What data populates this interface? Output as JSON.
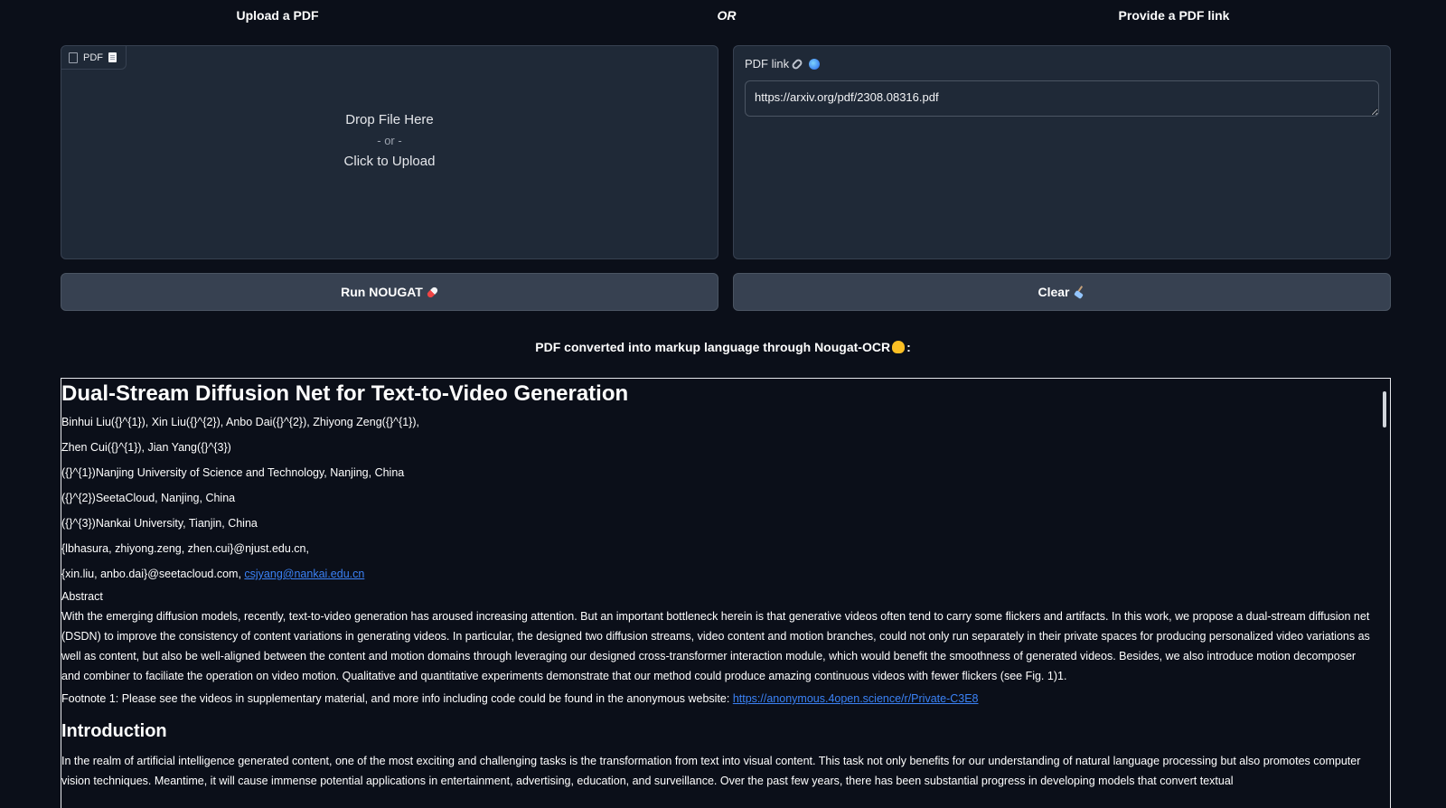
{
  "headers": {
    "upload": "Upload a PDF",
    "or": "OR",
    "link": "Provide a PDF link"
  },
  "upload": {
    "tag_label": "PDF",
    "drop_text": "Drop File Here",
    "or_text": "- or -",
    "click_text": "Click to Upload"
  },
  "link": {
    "label": "PDF link",
    "value": "https://arxiv.org/pdf/2308.08316.pdf"
  },
  "buttons": {
    "run": "Run NOUGAT",
    "clear": "Clear"
  },
  "result": {
    "title": "PDF converted into markup language through Nougat-OCR",
    "title_suffix": ":"
  },
  "document": {
    "title": "Dual-Stream Diffusion Net for Text-to-Video Generation",
    "authors_1": "Binhui Liu({}^{1}), Xin Liu({}^{2}), Anbo Dai({}^{2}), Zhiyong Zeng({}^{1}),",
    "authors_2": "Zhen Cui({}^{1}), Jian Yang({}^{3})",
    "affil_1": "({}^{1})Nanjing University of Science and Technology, Nanjing, China",
    "affil_2": "({}^{2})SeetaCloud, Nanjing, China",
    "affil_3": "({}^{3})Nankai University, Tianjin, China",
    "email_1": "{lbhasura, zhiyong.zeng, zhen.cui}@njust.edu.cn,",
    "email_2_prefix": "{xin.liu, anbo.dai}@seetacloud.com, ",
    "email_2_link": "csjyang@nankai.edu.cn",
    "abstract_label": "Abstract",
    "abstract_text": "With the emerging diffusion models, recently, text-to-video generation has aroused increasing attention. But an important bottleneck herein is that generative videos often tend to carry some flickers and artifacts. In this work, we propose a dual-stream diffusion net (DSDN) to improve the consistency of content variations in generating videos. In particular, the designed two diffusion streams, video content and motion branches, could not only run separately in their private spaces for producing personalized video variations as well as content, but also be well-aligned between the content and motion domains through leveraging our designed cross-transformer interaction module, which would benefit the smoothness of generated videos. Besides, we also introduce motion decomposer and combiner to faciliate the operation on video motion. Qualitative and quantitative experiments demonstrate that our method could produce amazing continuous videos with fewer flickers (see Fig. 1)1.",
    "footnote_prefix": "Footnote 1: Please see the videos in supplementary material, and more info including code could be found in the anonymous website: ",
    "footnote_link": "https://anonymous.4open.science/r/Private-C3E8",
    "intro_heading": "Introduction",
    "intro_text": "In the realm of artificial intelligence generated content, one of the most exciting and challenging tasks is the transformation from text into visual content. This task not only benefits for our understanding of natural language processing but also promotes computer vision techniques. Meantime, it will cause immense potential applications in entertainment, advertising, education, and surveillance. Over the past few years, there has been substantial progress in developing models that convert textual"
  },
  "icons": {
    "file": "file-icon",
    "pdf_doc": "page-emoji-icon",
    "link": "link-emoji-icon",
    "globe": "globe-emoji-icon",
    "pill": "pill-emoji-icon",
    "broom": "broom-emoji-icon",
    "hand": "pointing-down-hand-icon"
  },
  "colors": {
    "background": "#0b0f19",
    "panel": "#1f2937",
    "button": "#374151",
    "link": "#3b82f6"
  }
}
